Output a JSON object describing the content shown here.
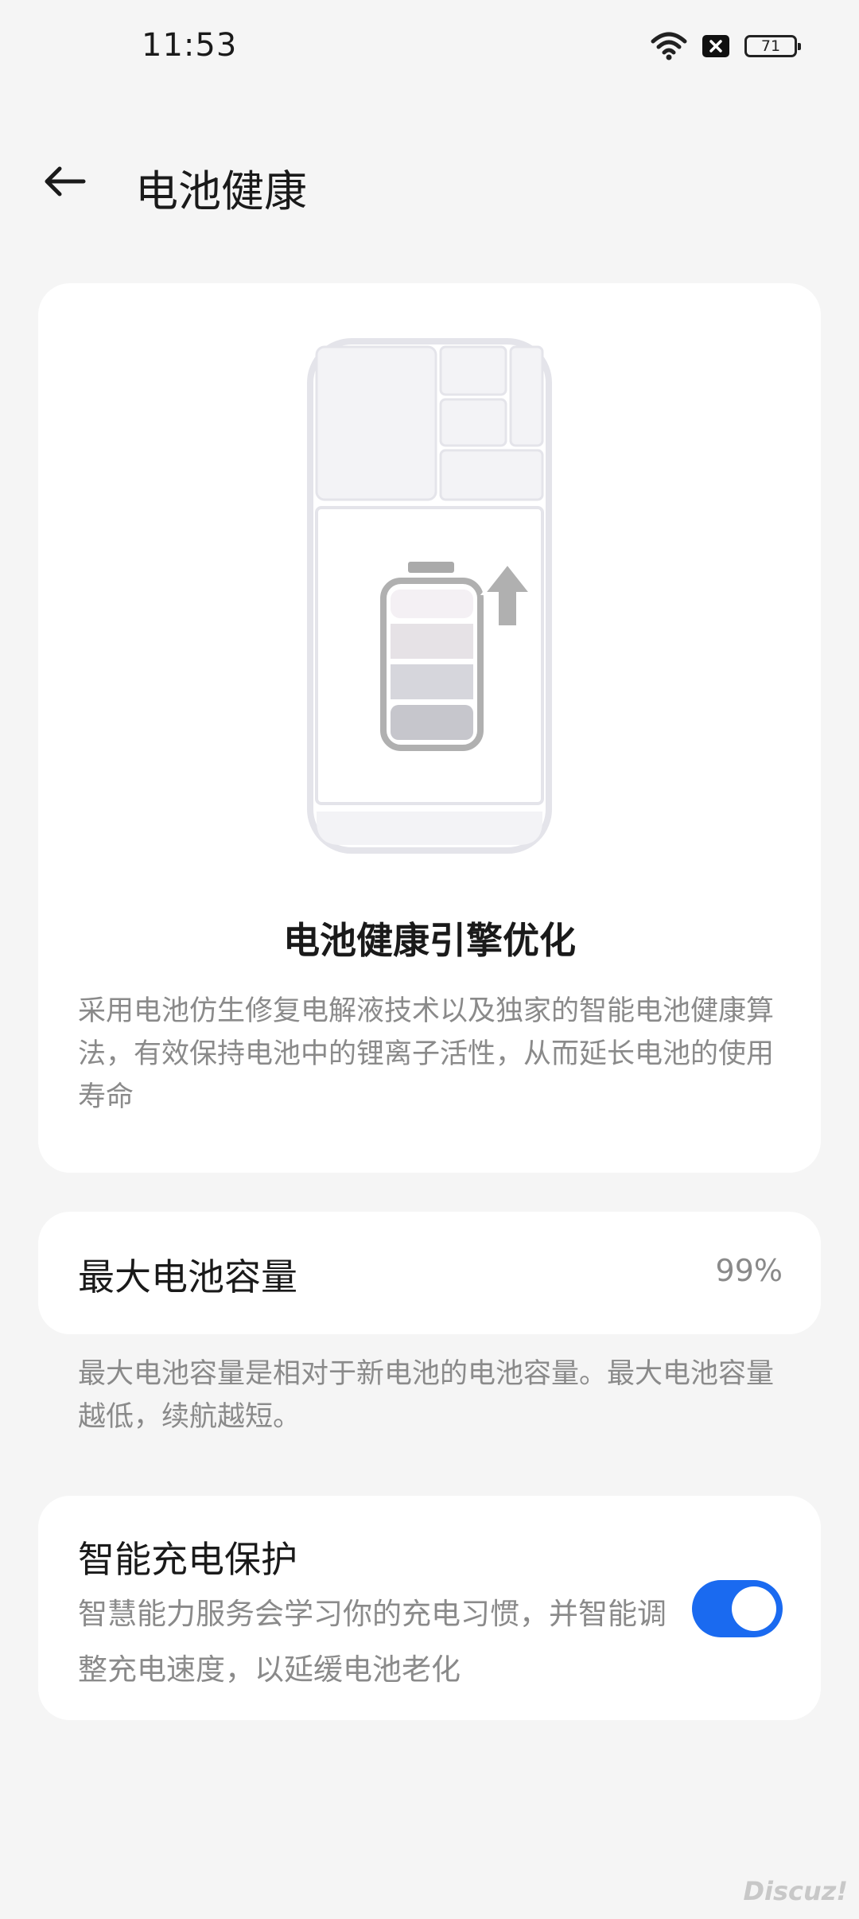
{
  "status_bar": {
    "time": "11:53",
    "battery_level": "71"
  },
  "header": {
    "title": "电池健康"
  },
  "hero": {
    "title": "电池健康引擎优化",
    "description": "采用电池仿生修复电解液技术以及独家的智能电池健康算法，有效保持电池中的锂离子活性，从而延长电池的使用寿命"
  },
  "capacity": {
    "label": "最大电池容量",
    "value": "99%",
    "note": "最大电池容量是相对于新电池的电池容量。最大电池容量越低，续航越短。"
  },
  "protection": {
    "title": "智能充电保护",
    "description": "智慧能力服务会学习你的充电习惯，并智能调整充电速度，以延缓电池老化",
    "enabled": true
  },
  "watermark": "Discuz!",
  "colors": {
    "accent": "#1a6af0",
    "background": "#f5f5f5",
    "card": "#ffffff",
    "secondary_text": "#8a8a8a"
  }
}
